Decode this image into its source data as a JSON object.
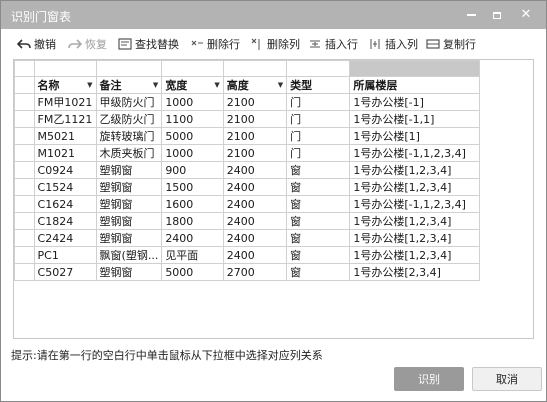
{
  "window": {
    "title": "识别门窗表"
  },
  "toolbar": {
    "undo": "撤销",
    "redo": "恢复",
    "find_replace": "查找替换",
    "delete_row": "删除行",
    "delete_col": "删除列",
    "insert_row": "插入行",
    "insert_col": "插入列",
    "copy_row": "复制行"
  },
  "table": {
    "headers": [
      "名称",
      "备注",
      "宽度",
      "高度",
      "类型",
      "所属楼层"
    ],
    "rows": [
      [
        "FM甲1021",
        "甲级防火门",
        "1000",
        "2100",
        "门",
        "1号办公楼[-1]"
      ],
      [
        "FM乙1121",
        "乙级防火门",
        "1100",
        "2100",
        "门",
        "1号办公楼[-1,1]"
      ],
      [
        "M5021",
        "旋转玻璃门",
        "5000",
        "2100",
        "门",
        "1号办公楼[1]"
      ],
      [
        "M1021",
        "木质夹板门",
        "1000",
        "2100",
        "门",
        "1号办公楼[-1,1,2,3,4]"
      ],
      [
        "C0924",
        "塑钢窗",
        "900",
        "2400",
        "窗",
        "1号办公楼[1,2,3,4]"
      ],
      [
        "C1524",
        "塑钢窗",
        "1500",
        "2400",
        "窗",
        "1号办公楼[1,2,3,4]"
      ],
      [
        "C1624",
        "塑钢窗",
        "1600",
        "2400",
        "窗",
        "1号办公楼[-1,1,2,3,4]"
      ],
      [
        "C1824",
        "塑钢窗",
        "1800",
        "2400",
        "窗",
        "1号办公楼[1,2,3,4]"
      ],
      [
        "C2424",
        "塑钢窗",
        "2400",
        "2400",
        "窗",
        "1号办公楼[1,2,3,4]"
      ],
      [
        "PC1",
        "飘窗(塑钢...",
        "见平面",
        "2400",
        "窗",
        "1号办公楼[1,2,3,4]"
      ],
      [
        "C5027",
        "塑钢窗",
        "5000",
        "2700",
        "窗",
        "1号办公楼[2,3,4]"
      ]
    ]
  },
  "hint": "提示:请在第一行的空白行中单击鼠标从下拉框中选择对应列关系",
  "buttons": {
    "ok": "识别",
    "cancel": "取消"
  }
}
